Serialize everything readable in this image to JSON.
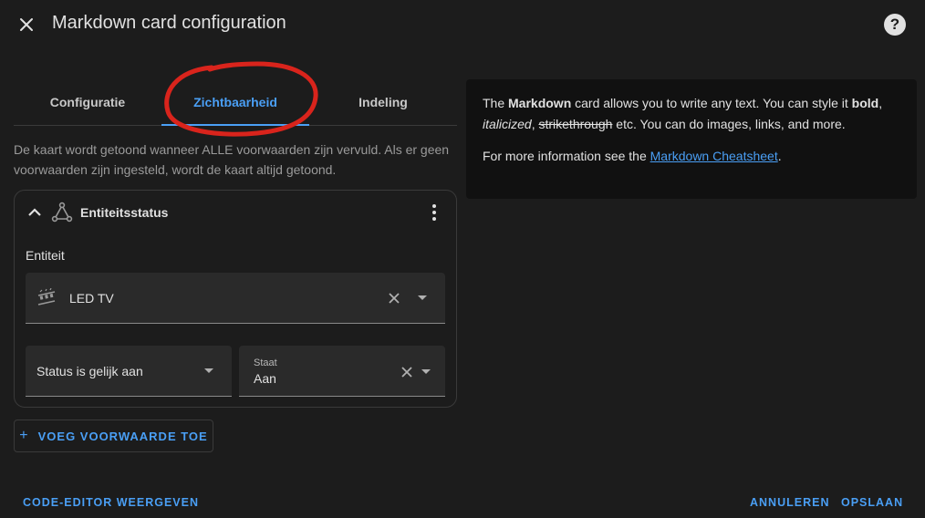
{
  "header": {
    "title": "Markdown card configuration",
    "close_icon": "close-icon",
    "help_icon": "help-icon",
    "help_glyph": "?"
  },
  "tabs": [
    {
      "label": "Configuratie",
      "selected": false
    },
    {
      "label": "Zichtbaarheid",
      "selected": true
    },
    {
      "label": "Indeling",
      "selected": false
    }
  ],
  "visibility": {
    "description": "De kaart wordt getoond wanneer ALLE voorwaarden zijn vervuld. Als er geen voorwaarden zijn ingesteld, wordt de kaart altijd getoond.",
    "condition": {
      "title": "Entiteitsstatus",
      "icon": "state-machine-icon",
      "entity_label": "Entiteit",
      "entity_value": "LED TV",
      "entity_icon": "led-strip-icon",
      "status_select": "Status is gelijk aan",
      "state_label": "Staat",
      "state_value": "Aan"
    },
    "add_condition_label": "VOEG VOORWAARDE TOE",
    "add_glyph": "+"
  },
  "preview": {
    "p1_a": "The ",
    "p1_bold_markdown": "Markdown",
    "p1_b": " card allows you to write any text. You can style it ",
    "p1_bold": "bold",
    "p1_c": ", ",
    "p1_italic": "italicized",
    "p1_d": ", ",
    "p1_strike": "strikethrough",
    "p1_e": " etc. You can do images, links, and more.",
    "p2_a": "For more information see the ",
    "p2_link": "Markdown Cheatsheet",
    "p2_b": "."
  },
  "footer": {
    "code_editor": "CODE-EDITOR WEERGEVEN",
    "cancel": "ANNULEREN",
    "save": "OPSLAAN"
  },
  "colors": {
    "accent": "#4a9ff5",
    "annotation": "#d9241c",
    "background": "#1c1c1c"
  }
}
